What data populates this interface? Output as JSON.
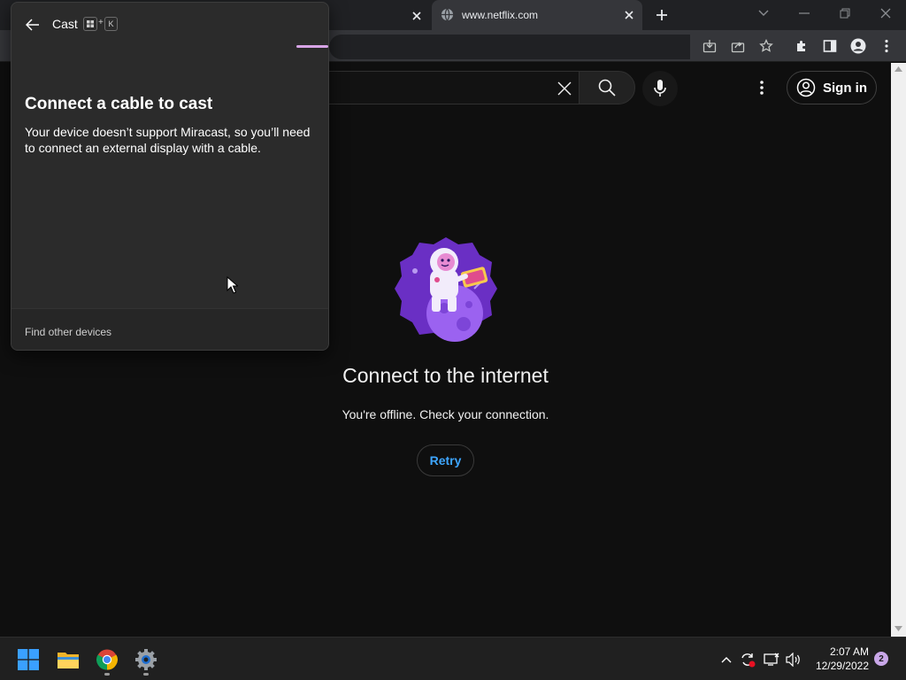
{
  "browser": {
    "prev_tab_close_symbol": "✕",
    "active_tab": {
      "title": "www.netflix.com",
      "favicon": "globe-icon"
    },
    "new_tab_symbol": "+"
  },
  "page": {
    "search_placeholder": "",
    "signin_label": "Sign in",
    "offline_title": "Connect to the internet",
    "offline_subtitle": "You're offline. Check your connection.",
    "retry_label": "Retry"
  },
  "cast": {
    "title": "Cast",
    "shortcut_key": "K",
    "shortcut_plus": "+",
    "heading": "Connect a cable to cast",
    "body": "Your device doesn’t support Miracast, so you’ll need to connect an external display with a cable.",
    "footer_link": "Find other devices",
    "accent": "#d7a4e6"
  },
  "taskbar": {
    "apps": [
      "windows-start",
      "file-explorer",
      "chrome",
      "settings"
    ],
    "time": "2:07 AM",
    "date": "12/29/2022",
    "notifications": "2"
  },
  "colors": {
    "page_bg": "#0f0f0f",
    "link_blue": "#3ea6ff",
    "illustration_purple": "#7b3fd6"
  }
}
